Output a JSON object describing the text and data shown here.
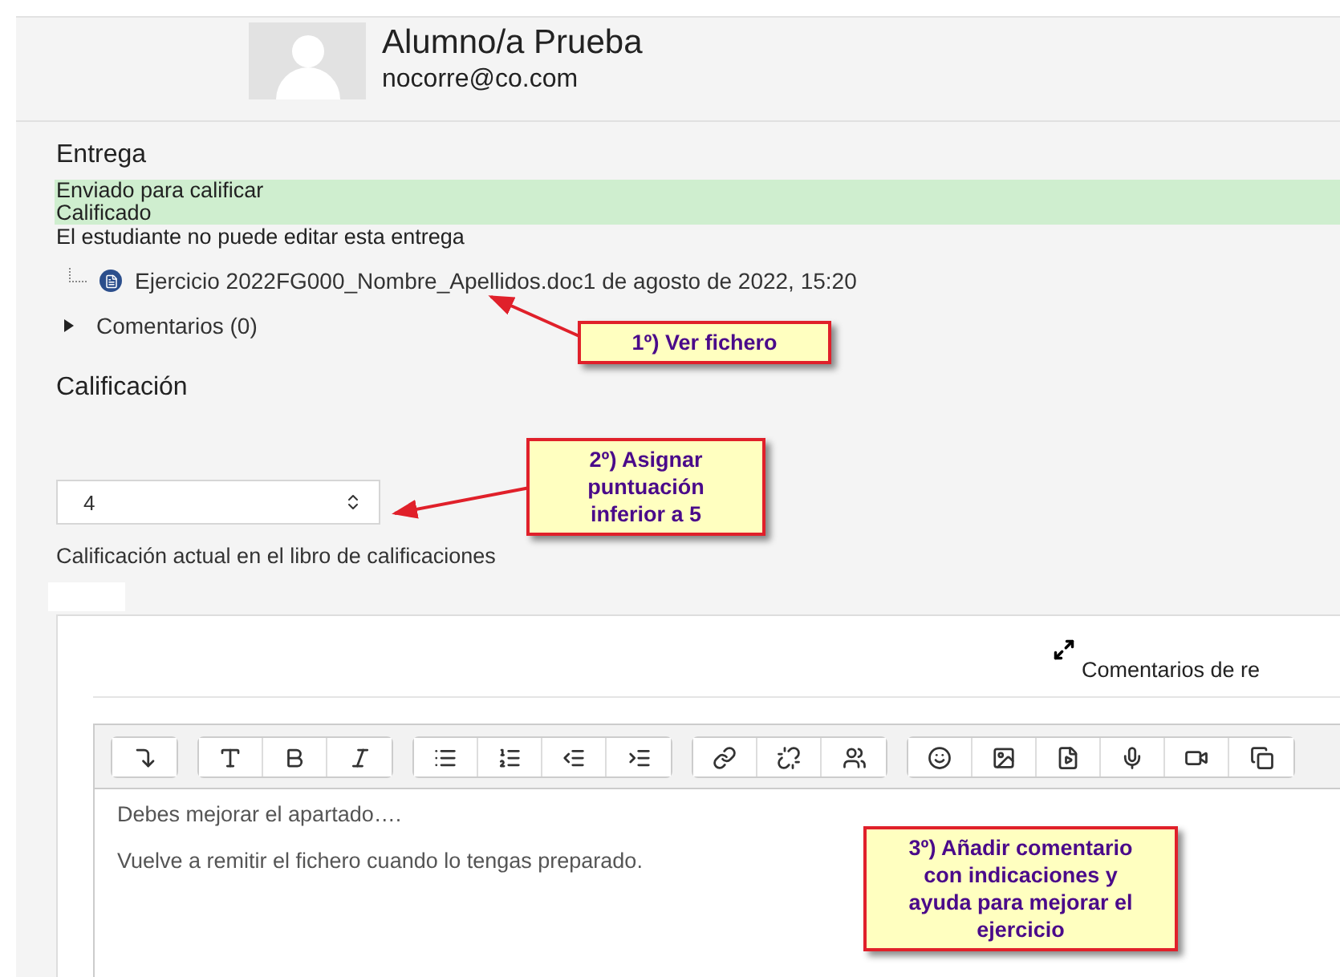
{
  "student": {
    "name": "Alumno/a Prueba",
    "email": "nocorre@co.com"
  },
  "submission": {
    "heading": "Entrega",
    "statuses": [
      "Enviado para calificar",
      "Calificado"
    ],
    "note": "El estudiante no puede editar esta entrega",
    "file": {
      "name": "Ejercicio 2022FG000_Nombre_Apellidos.doc",
      "date": "1 de agosto de 2022, 15:20"
    },
    "comments": {
      "label": "Comentarios (0)",
      "expanded": false
    }
  },
  "grading": {
    "heading": "Calificación",
    "grade": "4",
    "gradebook_label": "Calificación actual en el libro de calificaciones"
  },
  "feedback": {
    "title": "Comentarios de re",
    "lines": [
      "Debes mejorar el apartado….",
      "Vuelve a remitir el fichero cuando lo tengas preparado."
    ]
  },
  "callouts": [
    {
      "text": "1º) Ver fichero"
    },
    {
      "text": "2º) Asignar puntuación inferior a 5"
    },
    {
      "text": "3º)  Añadir comentario con indicaciones y ayuda para  mejorar el ejercicio"
    }
  ]
}
